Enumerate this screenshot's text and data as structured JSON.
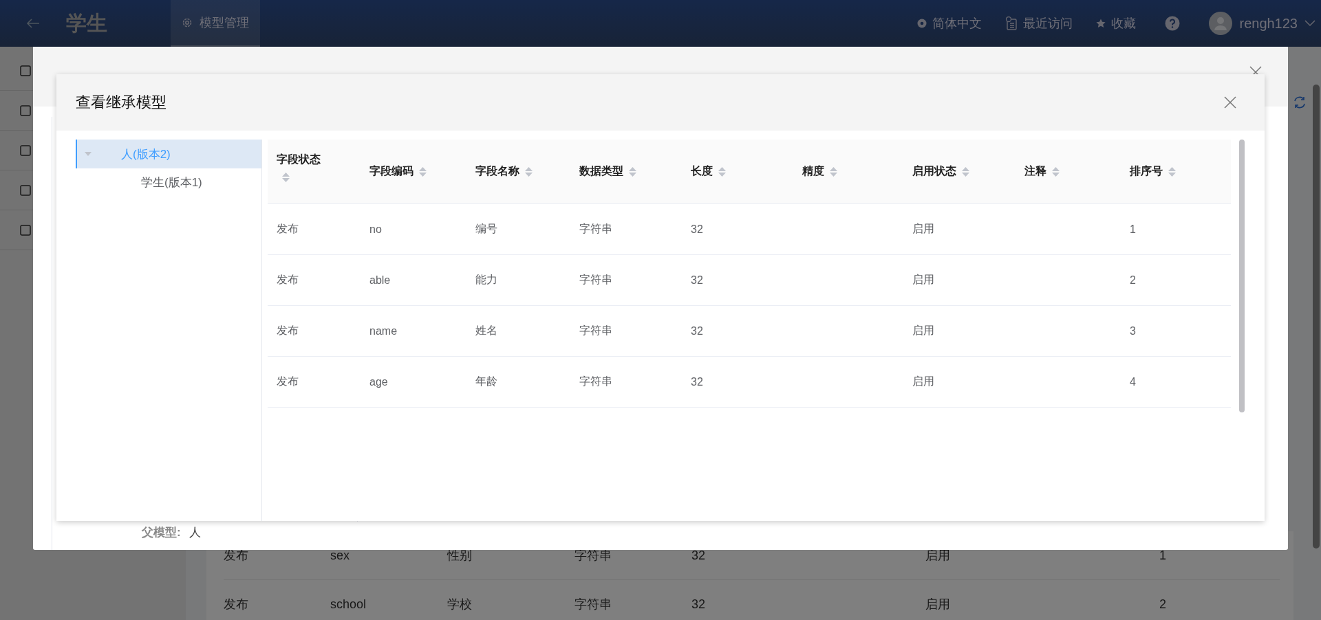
{
  "top_bar": {
    "title": "学生",
    "tabs": [
      {
        "label": "模型管理",
        "selected": true
      }
    ],
    "language": "简体中文",
    "recent": "最近访问",
    "favorites": "收藏",
    "user": "rengh123"
  },
  "background_table": {
    "rows": [
      {
        "status": "发布",
        "code": "sex",
        "name": "性别",
        "type": "字符串",
        "length": "32",
        "enabled": "启用",
        "order": "1"
      },
      {
        "status": "发布",
        "code": "school",
        "name": "学校",
        "type": "字符串",
        "length": "32",
        "enabled": "启用",
        "order": "2"
      }
    ]
  },
  "outer_dialog": {
    "parent_label": "父模型:",
    "parent_value": "人"
  },
  "inner_dialog": {
    "title": "查看继承模型",
    "tree": [
      {
        "label": "人(版本2)",
        "selected": true,
        "expanded": true,
        "children": [
          {
            "label": "学生(版本1)",
            "selected": false
          }
        ]
      }
    ],
    "table": {
      "columns": [
        "字段状态",
        "字段编码",
        "字段名称",
        "数据类型",
        "长度",
        "精度",
        "启用状态",
        "注释",
        "排序号"
      ],
      "rows": [
        {
          "status": "发布",
          "code": "no",
          "name": "编号",
          "type": "字符串",
          "length": "32",
          "enabled": "启用",
          "order": "1"
        },
        {
          "status": "发布",
          "code": "able",
          "name": "能力",
          "type": "字符串",
          "length": "32",
          "enabled": "启用",
          "order": "2"
        },
        {
          "status": "发布",
          "code": "name",
          "name": "姓名",
          "type": "字符串",
          "length": "32",
          "enabled": "启用",
          "order": "3"
        },
        {
          "status": "发布",
          "code": "age",
          "name": "年龄",
          "type": "字符串",
          "length": "32",
          "enabled": "启用",
          "order": "4"
        }
      ]
    }
  }
}
